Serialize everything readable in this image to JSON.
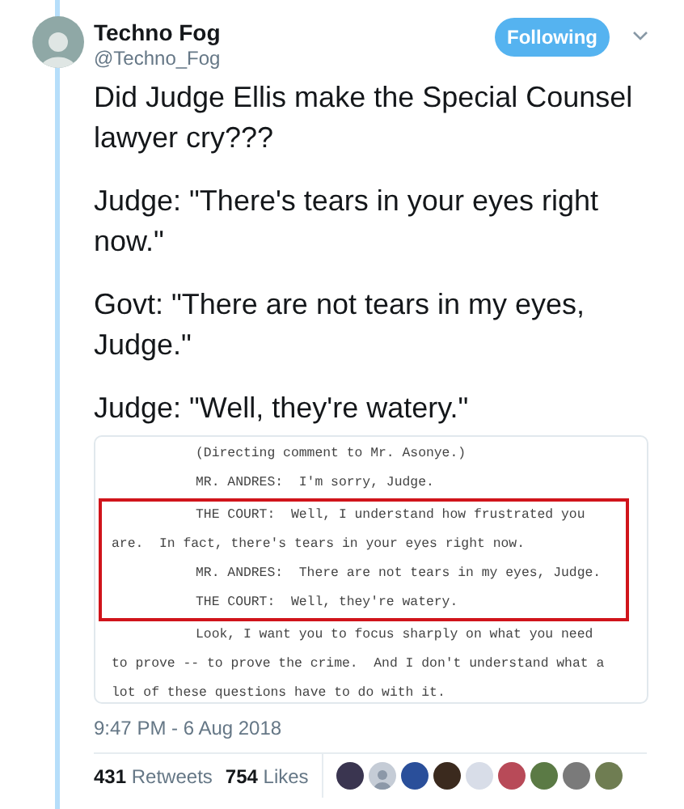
{
  "author": {
    "name": "Techno Fog",
    "handle": "@Techno_Fog"
  },
  "follow_button": {
    "label": "Following",
    "selected": true
  },
  "tweet": [
    "Did Judge Ellis make the Special Counsel lawyer cry???",
    "Judge: \"There's tears in your eyes right now.\"",
    "Govt: \"There are not tears in my eyes, Judge.\"",
    "Judge: \"Well, they're watery.\""
  ],
  "transcript": [
    {
      "highlighted": false,
      "lines": [
        {
          "text": "(Directing comment to Mr. Asonye.)",
          "indented": true
        },
        {
          "text": "MR. ANDRES:  I'm sorry, Judge.",
          "indented": true
        }
      ]
    },
    {
      "highlighted": true,
      "lines": [
        {
          "text": "THE COURT:  Well, I understand how frustrated you",
          "indented": true
        },
        {
          "text": "are.  In fact, there's tears in your eyes right now.",
          "indented": false
        },
        {
          "text": "MR. ANDRES:  There are not tears in my eyes, Judge.",
          "indented": true
        },
        {
          "text": "THE COURT:  Well, they're watery.",
          "indented": true
        }
      ]
    },
    {
      "highlighted": false,
      "lines": [
        {
          "text": "Look, I want you to focus sharply on what you need",
          "indented": true
        },
        {
          "text": "to prove -- to prove the crime.  And I don't understand what a",
          "indented": false
        },
        {
          "text": "lot of these questions have to do with it.",
          "indented": false
        }
      ]
    }
  ],
  "timestamp": "9:47 PM - 6 Aug 2018",
  "stats": [
    {
      "count": "431",
      "label": "Retweets"
    },
    {
      "count": "754",
      "label": "Likes"
    }
  ],
  "likers": [
    {
      "color": "#3a3550"
    },
    {
      "color": "#c5ccd6",
      "kind": "default"
    },
    {
      "color": "#2a4f9a"
    },
    {
      "color": "#3b2a1e"
    },
    {
      "color": "#d8dde8"
    },
    {
      "color": "#b84a58"
    },
    {
      "color": "#5b7a45"
    },
    {
      "color": "#7a7a7a"
    },
    {
      "color": "#6f7d52"
    }
  ]
}
